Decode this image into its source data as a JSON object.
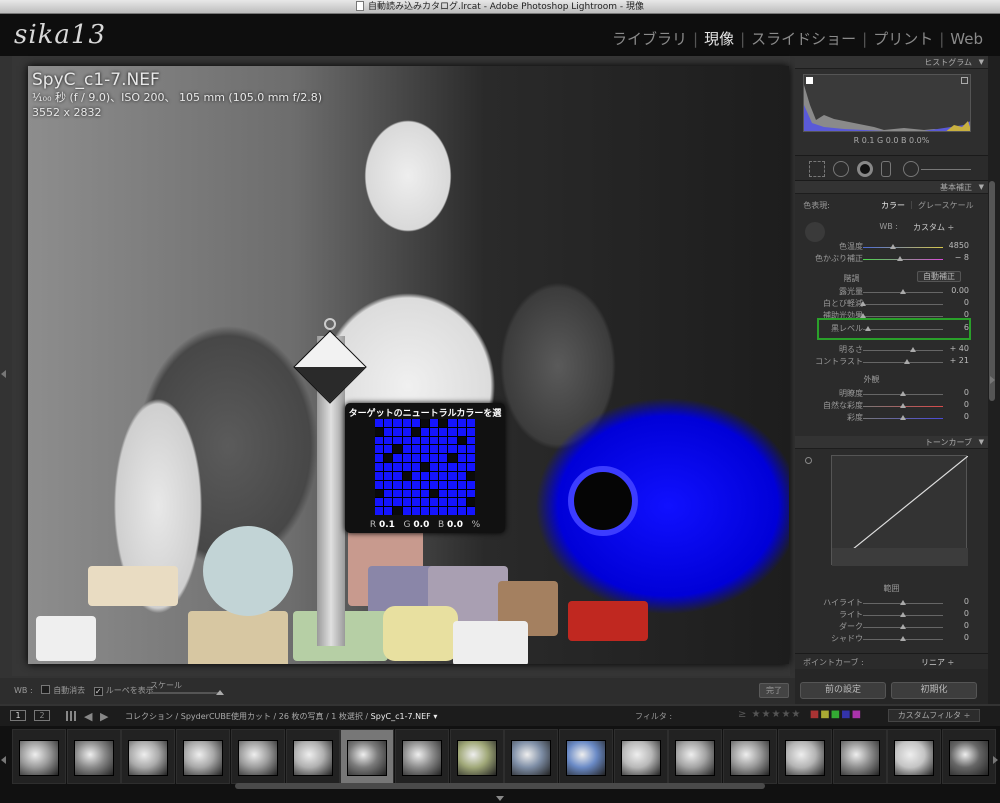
{
  "window": {
    "title": "自動読み込みカタログ.lrcat - Adobe Photoshop Lightroom - 現像"
  },
  "header": {
    "identity_plate": "sika13",
    "modules": [
      "ライブラリ",
      "現像",
      "スライドショー",
      "プリント",
      "Web"
    ],
    "active_module": "現像",
    "separator": "|"
  },
  "photo": {
    "filename": "SpyC_c1-7.NEF",
    "exif": "¹⁄₁₀₀ 秒 (f / 9.0)、ISO 200、 105 mm (105.0 mm f/2.8)",
    "dimensions": "3552 x 2832"
  },
  "loupe": {
    "title": "ターゲットのニュートラルカラーを選択",
    "r_label": "R",
    "r": "0.1",
    "g_label": "G",
    "g": "0.0",
    "b_label": "B",
    "b": "0.0",
    "unit": "%",
    "grid": [
      "11111010111",
      "01110111111",
      "11111111101",
      "11011111111",
      "10111111011",
      "11111011111",
      "11101111110",
      "11111111111",
      "01111101111",
      "11111111110",
      "11011111111"
    ]
  },
  "toolbar": {
    "wb_label": "WB :",
    "auto_dismiss": "自動消去",
    "auto_dismiss_checked": false,
    "show_loupe": "ルーペを表示",
    "show_loupe_checked": true,
    "scale": "スケール",
    "done": "完了"
  },
  "panels": {
    "histogram": {
      "title": "ヒストグラム",
      "readout": "R  0.1  G  0.0  B  0.0%"
    },
    "basic": {
      "title": "基本補正",
      "treatment_label": "色表現:",
      "color": "カラー",
      "grayscale": "グレースケール",
      "wb_label": "WB :",
      "wb_value": "カスタム ÷",
      "temp": {
        "label": "色温度",
        "value": "4850",
        "pos": 0.38
      },
      "tint": {
        "label": "色かぶり補正",
        "value": "− 8",
        "pos": 0.46
      },
      "tone_label": "階調",
      "auto": "自動補正",
      "exposure": {
        "label": "露光量",
        "value": "0.00",
        "pos": 0.5
      },
      "recovery": {
        "label": "白とび軽減",
        "value": "0",
        "pos": 0.0
      },
      "fill": {
        "label": "補助光効果",
        "value": "0",
        "pos": 0.0
      },
      "blacks": {
        "label": "黒レベル",
        "value": "6",
        "pos": 0.06
      },
      "brightness": {
        "label": "明るさ",
        "value": "+ 40",
        "pos": 0.62
      },
      "contrast": {
        "label": "コントラスト",
        "value": "+ 21",
        "pos": 0.55
      },
      "presence_label": "外観",
      "clarity": {
        "label": "明瞭度",
        "value": "0",
        "pos": 0.5
      },
      "vibrance": {
        "label": "自然な彩度",
        "value": "0",
        "pos": 0.5
      },
      "saturation": {
        "label": "彩度",
        "value": "0",
        "pos": 0.5
      }
    },
    "tonecurve": {
      "title": "トーンカーブ",
      "region": "範囲",
      "highlights": {
        "label": "ハイライト",
        "value": "0"
      },
      "lights": {
        "label": "ライト",
        "value": "0"
      },
      "darks": {
        "label": "ダーク",
        "value": "0"
      },
      "shadows": {
        "label": "シャドウ",
        "value": "0"
      },
      "point_curve_label": "ポイントカーブ :",
      "point_curve": "リニア ÷"
    },
    "prev": "前の設定",
    "reset": "初期化"
  },
  "filmbar": {
    "monitor1": "1",
    "monitor2": "2",
    "breadcrumb": "コレクション / SpyderCUBE使用カット / 26 枚の写真 / 1 枚選択 / ",
    "current": "SpyC_c1-7.NEF ▾",
    "filter_label": "フィルタ :",
    "custom_filter": "カスタムフィルタ ÷"
  },
  "filmstrip": {
    "count": 18,
    "selected": 6
  }
}
